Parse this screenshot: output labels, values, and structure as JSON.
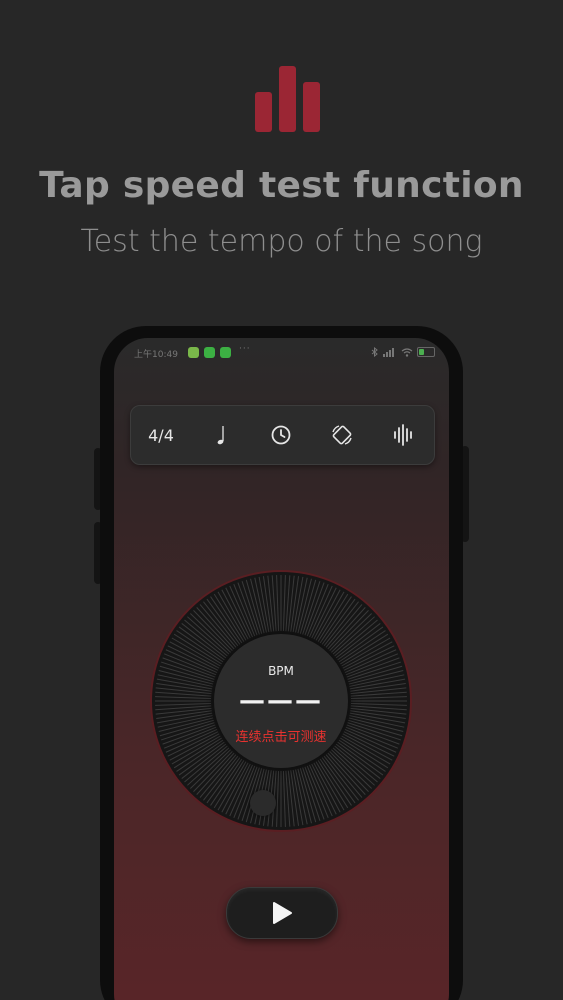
{
  "promo": {
    "title": "Tap speed test function",
    "subtitle": "Test the tempo of the song",
    "logo_icon": "bar-chart-icon",
    "accent_color": "#9b2634"
  },
  "status_bar": {
    "time": "上午10:49",
    "more": "···"
  },
  "toolbar": {
    "time_signature": "4/4",
    "note_icon": "quarter-note-icon",
    "timer_icon": "clock-icon",
    "rotate_icon": "rotate-device-icon",
    "sound_icon": "sound-wave-icon"
  },
  "tempo": {
    "bpm_label": "BPM",
    "bpm_value": "———",
    "hint": "连续点击可测速",
    "hint_color": "#e8322f"
  },
  "controls": {
    "play_icon": "play-icon"
  }
}
